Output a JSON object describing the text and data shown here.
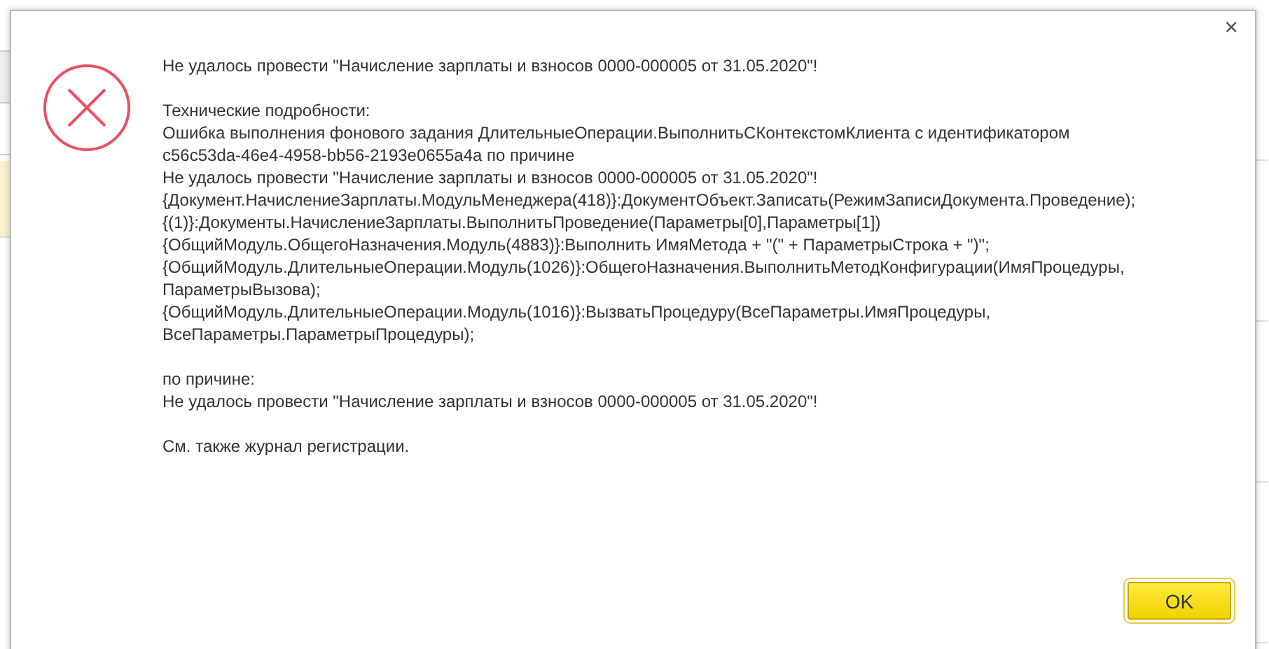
{
  "dialog": {
    "close_label": "×",
    "paragraphs": [
      [
        "Не удалось провести \"Начисление зарплаты и взносов 0000-000005 от 31.05.2020\"!"
      ],
      [
        "Технические подробности:",
        "Ошибка выполнения фонового задания ДлительныеОперации.ВыполнитьСКонтекстомКлиента с идентификатором",
        "c56c53da-46e4-4958-bb56-2193e0655a4a по причине",
        "Не удалось провести \"Начисление зарплаты и взносов 0000-000005 от 31.05.2020\"!",
        "{Документ.НачислениеЗарплаты.МодульМенеджера(418)}:ДокументОбъект.Записать(РежимЗаписиДокумента.Проведение);",
        "{(1)}:Документы.НачислениеЗарплаты.ВыполнитьПроведение(Параметры[0],Параметры[1])",
        "{ОбщийМодуль.ОбщегоНазначения.Модуль(4883)}:Выполнить ИмяМетода + \"(\" + ПараметрыСтрока + \")\";",
        "{ОбщийМодуль.ДлительныеОперации.Модуль(1026)}:ОбщегоНазначения.ВыполнитьМетодКонфигурации(ИмяПроцедуры,",
        "ПараметрыВызова);",
        "{ОбщийМодуль.ДлительныеОперации.Модуль(1016)}:ВызватьПроцедуру(ВсеПараметры.ИмяПроцедуры,",
        "ВсеПараметры.ПараметрыПроцедуры);"
      ],
      [
        "по причине:",
        "Не удалось провести \"Начисление зарплаты и взносов 0000-000005 от 31.05.2020\"!"
      ],
      [
        "См. также журнал регистрации."
      ]
    ],
    "buttons": [
      {
        "label": "OK",
        "selected": true
      }
    ]
  }
}
